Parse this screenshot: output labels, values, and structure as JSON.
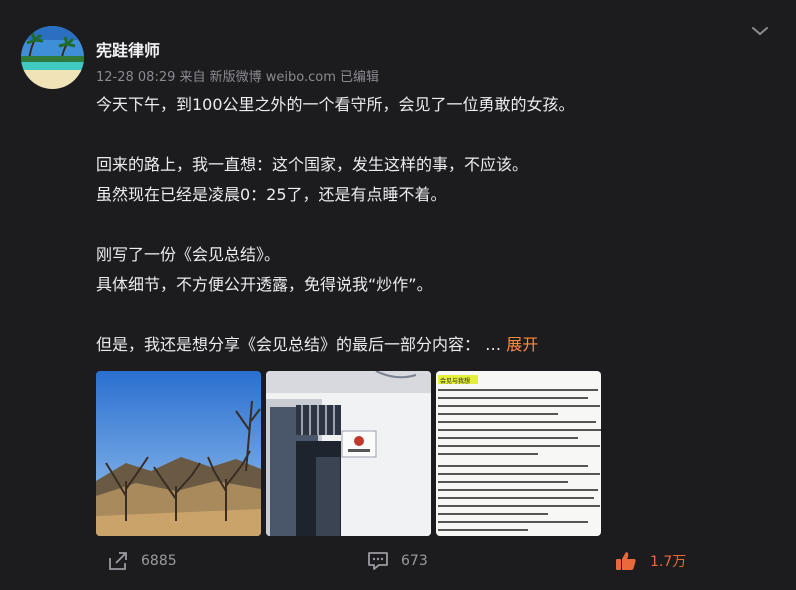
{
  "post": {
    "author": "宪跬律师",
    "meta": "12-28 08:29  来自 新版微博 weibo.com 已编辑",
    "lines": [
      "今天下午，到100公里之外的一个看守所，会见了一位勇敢的女孩。",
      "",
      "回来的路上，我一直想：这个国家，发生这样的事，不应该。",
      "虽然现在已经是凌晨0：25了，还是有点睡不着。",
      "",
      "刚写了一份《会见总结》。",
      "具体细节，不方便公开透露，免得说我“炒作”。",
      ""
    ],
    "last_line": "但是，我还是想分享《会见总结》的最后一部分内容：  … ",
    "expand_label": "展开",
    "images": [
      {
        "desc": "mountain-trees-photo"
      },
      {
        "desc": "building-door-photo"
      },
      {
        "desc": "document-text-photo",
        "heading": "会见与我想"
      }
    ]
  },
  "actions": {
    "share_count": "6885",
    "comment_count": "673",
    "like_count": "1.7万"
  },
  "colors": {
    "background": "#1c1c1f",
    "accent": "#ff8a3d",
    "like": "#e86a3c",
    "muted": "#8a8a90"
  },
  "icons": [
    "chevron-down-icon",
    "share-icon",
    "comment-icon",
    "like-icon"
  ]
}
